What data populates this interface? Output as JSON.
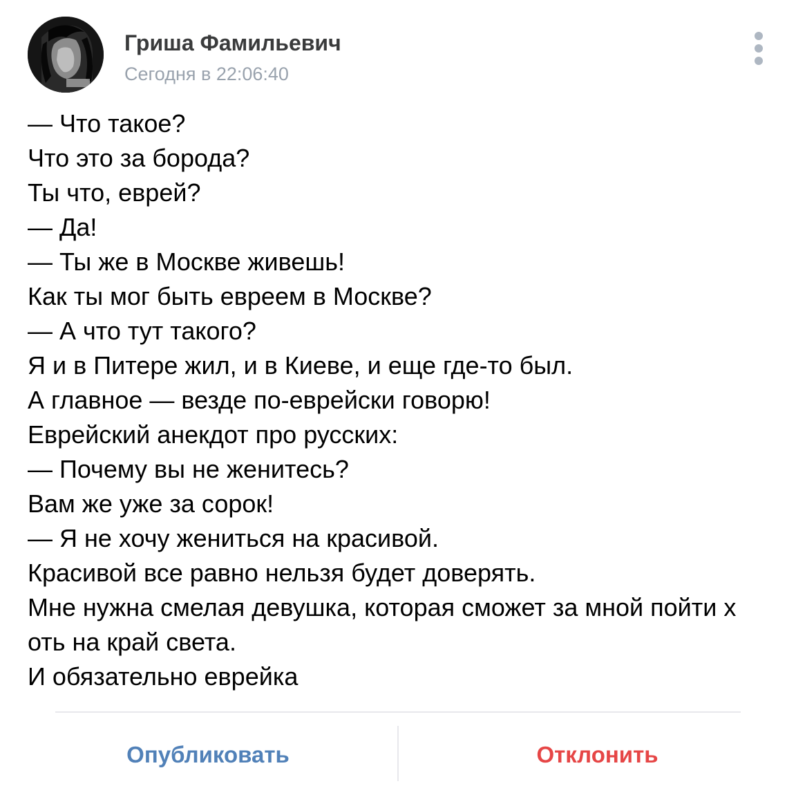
{
  "post": {
    "author": "Гриша Фамильевич",
    "timestamp": "Сегодня в 22:06:40",
    "lines": [
      "— Что такое?",
      "Что это за борода?",
      "Ты что, еврей?",
      "— Да!",
      "— Ты же в Москве живешь!",
      "Как ты мог быть евреем в Москве?",
      "— А что тут такого?",
      "Я и в Питере жил, и в Киеве, и еще где-то был.",
      "А главное — везде по-еврейски говорю!",
      "Еврейский анекдот про русских:",
      "— Почему вы не женитесь?",
      "Вам же уже за сорок!",
      "— Я не хочу жениться на красивой.",
      "Красивой все равно нельзя будет доверять.",
      "Мне нужна смелая девушка, которая сможет за мной пойти х",
      "оть на край света.",
      "И обязательно еврейка"
    ]
  },
  "actions": {
    "publish_label": "Опубликовать",
    "reject_label": "Отклонить"
  },
  "icons": {
    "avatar": "avatar-image",
    "menu": "more-vertical-icon"
  },
  "colors": {
    "publish": "#5181b8",
    "reject": "#e64646",
    "meta": "#99a2ad",
    "divider": "#e7e8ec"
  }
}
